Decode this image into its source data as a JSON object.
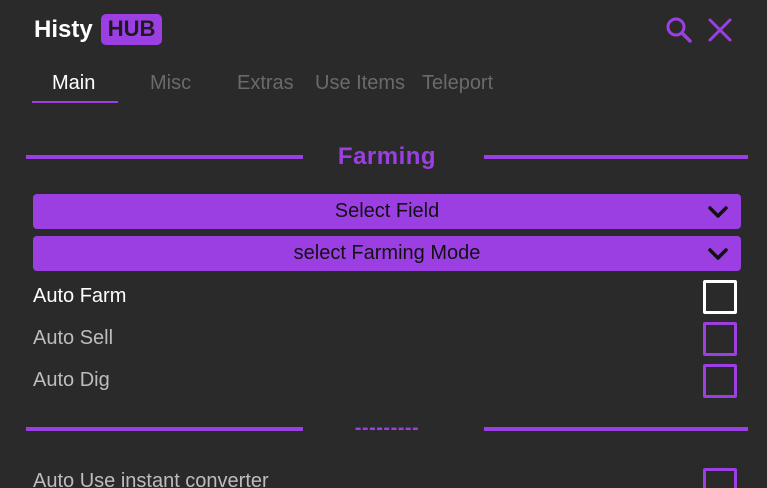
{
  "header": {
    "title": "Histy",
    "badge": "HUB"
  },
  "icons": [
    "search-icon",
    "close-icon"
  ],
  "tabs": [
    {
      "label": "Main",
      "active": true
    },
    {
      "label": "Misc",
      "active": false
    },
    {
      "label": "Extras",
      "active": false
    },
    {
      "label": "Use Items",
      "active": false
    },
    {
      "label": "Teleport",
      "active": false
    }
  ],
  "sections": [
    {
      "title": "Farming"
    },
    {
      "title": "---------"
    }
  ],
  "dropdowns": [
    {
      "label": "Select Field"
    },
    {
      "label": "select Farming Mode"
    }
  ],
  "toggles": [
    {
      "label": "Auto Farm",
      "checked": false
    },
    {
      "label": "Auto Sell",
      "checked": false
    },
    {
      "label": "Auto Dig",
      "checked": false
    },
    {
      "label": "Auto Use instant converter",
      "checked": false
    }
  ],
  "colors": {
    "accent": "#9b3fe3",
    "background": "#2a2a2a",
    "text": "#ffffff",
    "muted": "#6a6a6a"
  }
}
